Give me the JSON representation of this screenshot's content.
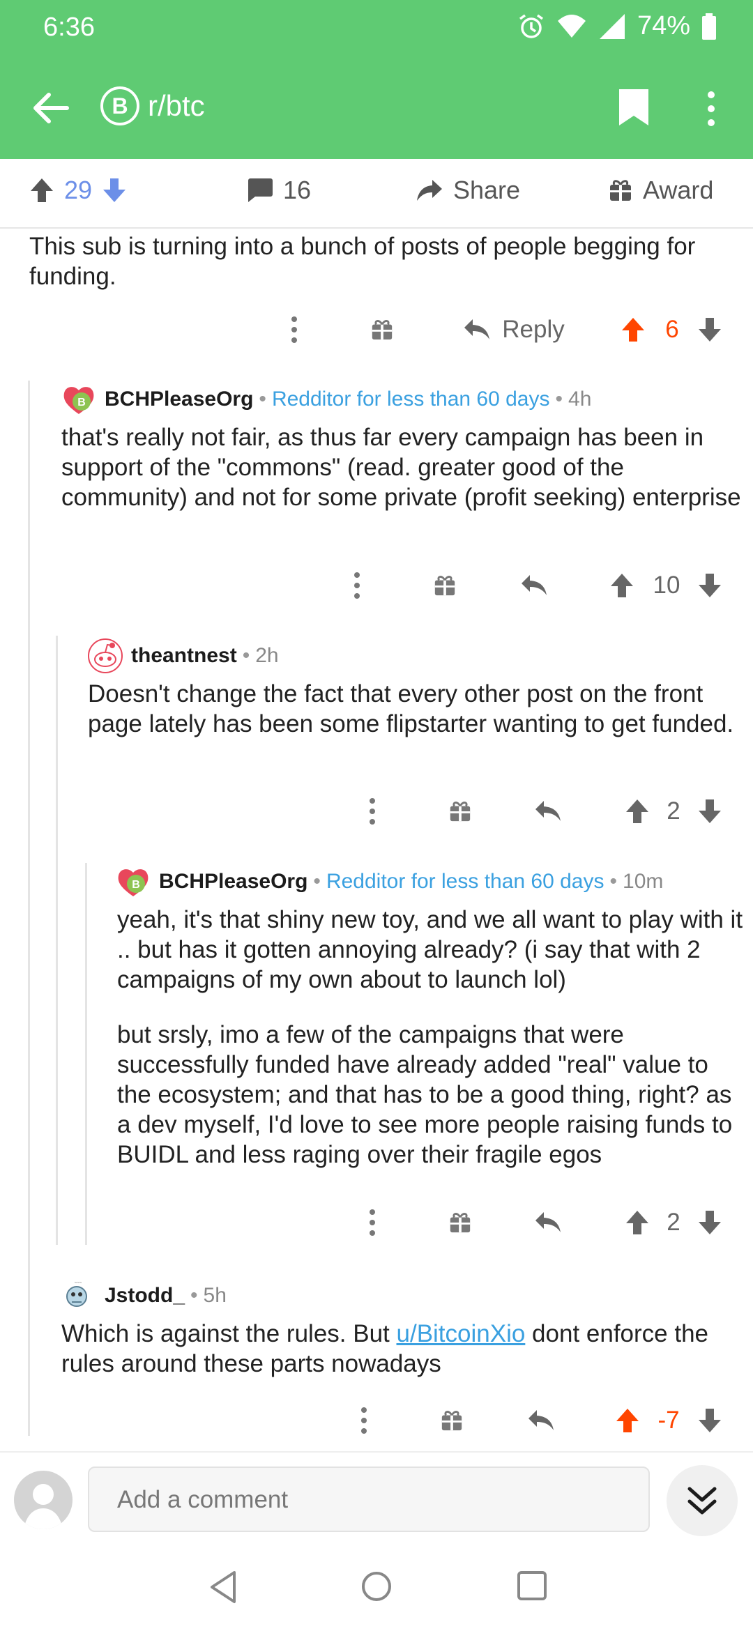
{
  "status": {
    "time": "6:36",
    "battery": "74%"
  },
  "header": {
    "subreddit": "r/btc",
    "subreddit_icon_text": "B"
  },
  "post_actions": {
    "score": "29",
    "comments": "16",
    "share": "Share",
    "award": "Award"
  },
  "comments": [
    {
      "id": "c0",
      "body": [
        "This sub is turning into a bunch of posts of people begging for funding."
      ],
      "score": "6",
      "reply_label": "Reply",
      "vote_state": "upvoted"
    },
    {
      "id": "c1",
      "author": "BCHPleaseOrg",
      "flair": "Redditor for less than 60 days",
      "time": "4h",
      "body": [
        "that's really not fair, as thus far every campaign has been in support of the \"commons\" (read. greater good of the community) and not for some private (profit seeking) enterprise"
      ],
      "score": "10"
    },
    {
      "id": "c2",
      "author": "theantnest",
      "time": "2h",
      "body": [
        "Doesn't change the fact that every other post on the front page lately has been some flipstarter wanting to get funded."
      ],
      "score": "2"
    },
    {
      "id": "c3",
      "author": "BCHPleaseOrg",
      "flair": "Redditor for less than 60 days",
      "time": "10m",
      "body": [
        "yeah, it's that shiny new toy, and we all want to play with it .. but has it gotten annoying already? (i say that with 2 campaigns of my own about to launch lol)",
        "but srsly, imo a few of the campaigns that were successfully funded have already added \"real\" value to the ecosystem; and that has to be a good thing, right? as a dev myself, I'd love to see more people raising funds to BUIDL and less raging over their fragile egos"
      ],
      "score": "2"
    },
    {
      "id": "c4",
      "author": "Jstodd_",
      "time": "5h",
      "body_before": "Which is against the rules. But ",
      "body_link": "u/BitcoinXio",
      "body_after": " dont enforce the rules around these parts nowadays",
      "score": "-7",
      "vote_state": "upvoted"
    }
  ],
  "composer": {
    "placeholder": "Add a comment"
  },
  "colors": {
    "header_green": "#5fcb73",
    "upvote_orange": "#ff4500",
    "score_blue": "#6c8fe8",
    "flair_blue": "#3aa0e0"
  },
  "icons": [
    "back-arrow-icon",
    "bitcoin-icon",
    "bookmark-icon",
    "more-vert-icon",
    "upvote-icon",
    "downvote-icon",
    "comment-icon",
    "share-icon",
    "gift-icon",
    "reply-icon",
    "double-chevron-down-icon"
  ]
}
